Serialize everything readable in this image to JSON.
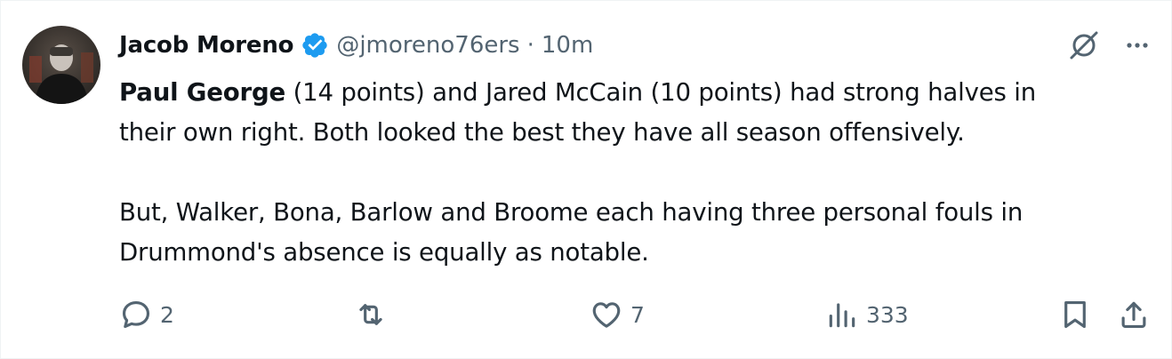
{
  "colors": {
    "text": "#0f1419",
    "secondary": "#536471",
    "verified": "#1d9bf0",
    "background": "#ffffff"
  },
  "author": {
    "display_name": "Jacob Moreno",
    "handle": "@jmoreno76ers",
    "separator": "·",
    "time": "10m",
    "verified": true
  },
  "tweet": {
    "bold_lead": "Paul George",
    "line1_rest": " (14 points) and Jared McCain (10 points) had strong halves in",
    "line2": "their own right. Both looked the best they have all season offensively.",
    "line3": "But, Walker, Bona, Barlow and Broome each having three personal fouls in",
    "line4": "Drummond's absence is equally as notable."
  },
  "actions": {
    "replies": "2",
    "reposts": "",
    "likes": "7",
    "views": "333"
  },
  "icons": {
    "top": [
      "grok-icon",
      "more-icon"
    ],
    "bottom": [
      "reply-icon",
      "repost-icon",
      "like-icon",
      "views-icon",
      "bookmark-icon",
      "share-icon"
    ]
  }
}
